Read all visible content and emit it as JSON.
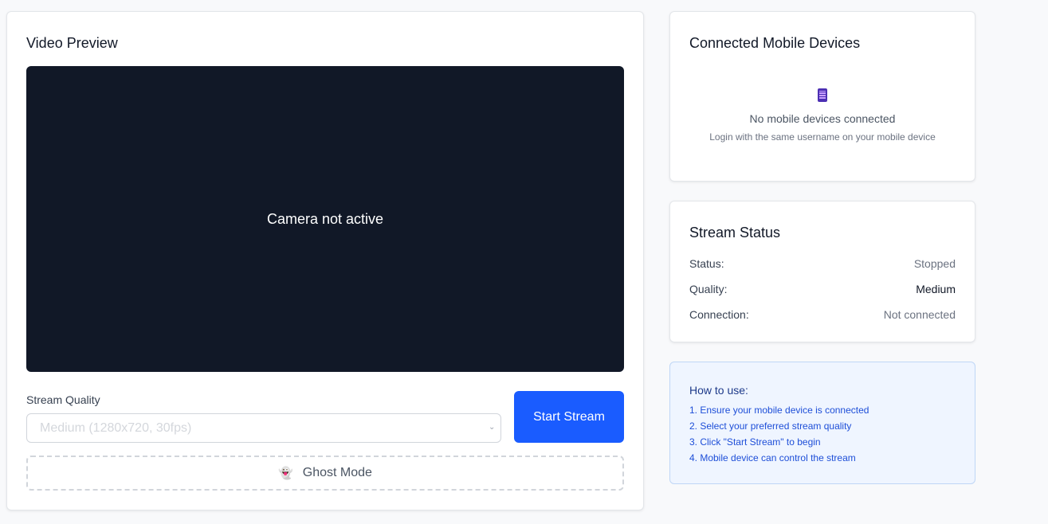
{
  "video": {
    "title": "Video Preview",
    "preview_text": "Camera not active",
    "quality_label": "Stream Quality",
    "quality_selected": "Medium (1280x720, 30fps)",
    "start_button": "Start Stream",
    "ghost_button": "Ghost Mode",
    "ghost_icon": "ghost-icon"
  },
  "devices": {
    "title": "Connected Mobile Devices",
    "icon": "mobile-phone-icon",
    "empty_text": "No mobile devices connected",
    "hint": "Login with the same username on your mobile device"
  },
  "status": {
    "title": "Stream Status",
    "rows": [
      {
        "label": "Status:",
        "value": "Stopped"
      },
      {
        "label": "Quality:",
        "value": "Medium"
      },
      {
        "label": "Connection:",
        "value": "Not connected"
      }
    ]
  },
  "howto": {
    "title": "How to use:",
    "steps": [
      "1. Ensure your mobile device is connected",
      "2. Select your preferred stream quality",
      "3. Click \"Start Stream\" to begin",
      "4. Mobile device can control the stream"
    ]
  },
  "colors": {
    "primary": "#1a5cff",
    "preview_bg": "#111827",
    "howto_bg": "#eff5ff"
  }
}
